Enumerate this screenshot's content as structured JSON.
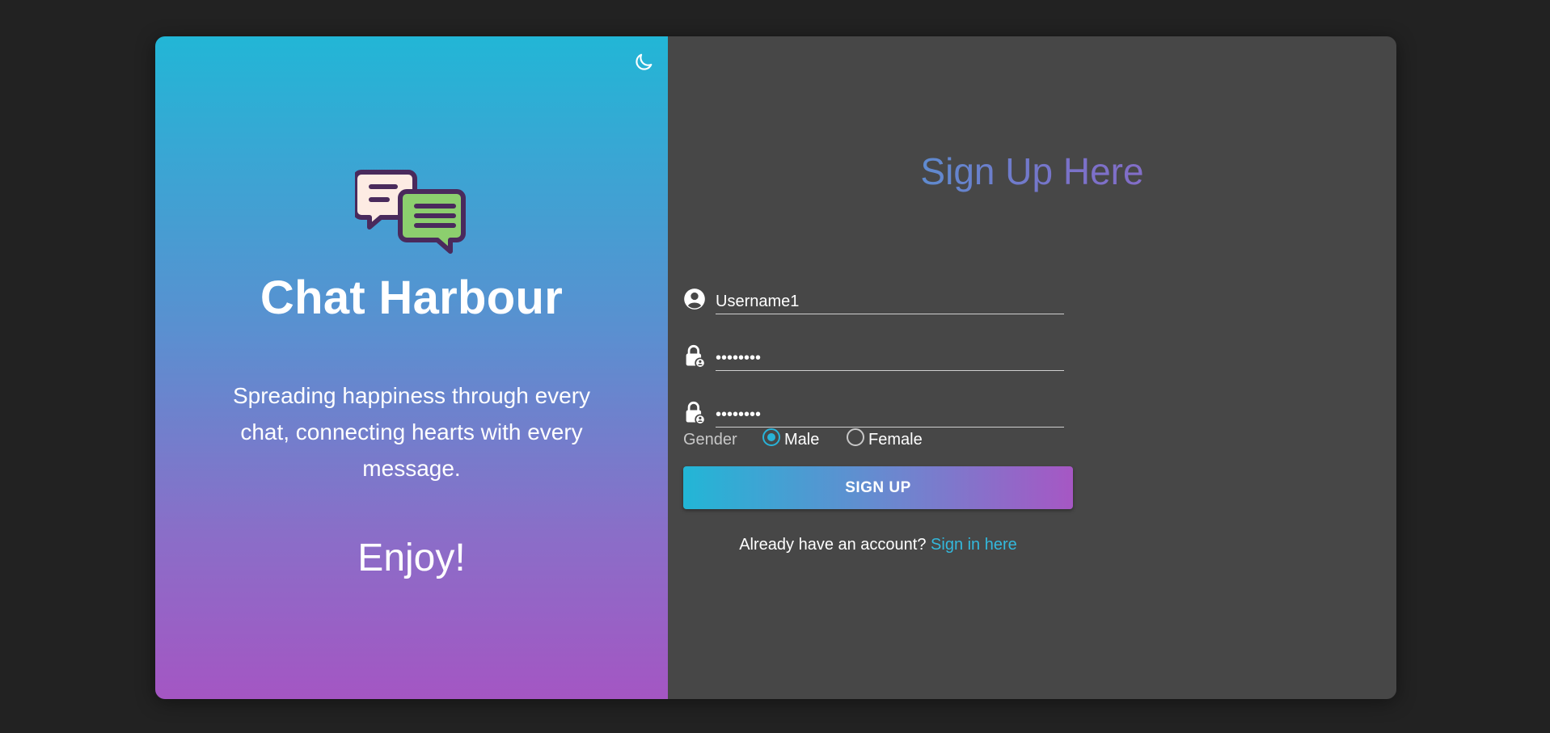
{
  "brand": {
    "name": "Chat Harbour",
    "tagline": "Spreading happiness through every chat, connecting hearts with every message.",
    "closing": "Enjoy!"
  },
  "theme_toggle": {
    "icon": "moon-icon"
  },
  "form": {
    "heading": "Sign Up Here",
    "username": {
      "value": "Username1",
      "icon": "user-circle-icon"
    },
    "password": {
      "value": "••••••••",
      "icon": "lock-icon"
    },
    "confirm_password": {
      "value": "••••••••",
      "icon": "lock-icon"
    },
    "gender": {
      "label": "Gender",
      "options": [
        "Male",
        "Female"
      ],
      "selected": "Male"
    },
    "submit_label": "SIGN UP",
    "signin_prompt": "Already have an account?",
    "signin_link": "Sign in here"
  },
  "colors": {
    "page_background": "#222222",
    "panel_background": "#474747",
    "accent_cyan": "#22b6d6",
    "accent_purple": "#a456c3"
  }
}
